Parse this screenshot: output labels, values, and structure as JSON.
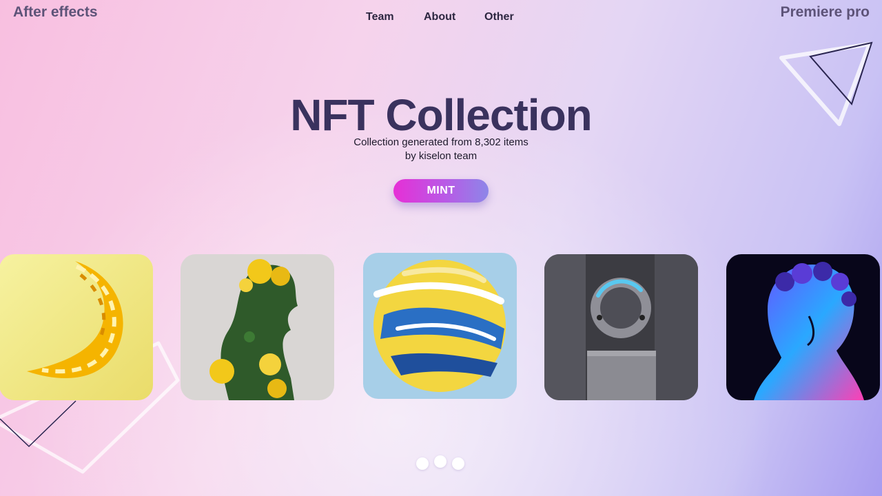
{
  "header": {
    "left_brand": "After effects",
    "right_brand": "Premiere pro",
    "nav": [
      "Team",
      "About",
      "Other"
    ]
  },
  "hero": {
    "title": "NFT Collection",
    "subtitle_line1": "Collection generated from 8,302 items",
    "subtitle_line2": "by kiselon team",
    "cta_label": "MINT"
  },
  "gallery": {
    "cards": [
      {
        "subject": "yellow braided crescent"
      },
      {
        "subject": "floral silhouette of a woman"
      },
      {
        "subject": "painted sphere"
      },
      {
        "subject": "grey machine with ring"
      },
      {
        "subject": "holographic bust statue"
      }
    ],
    "pagination_count": 3
  },
  "colors": {
    "title": "#3a325e",
    "brand_text": "#5d5378",
    "mint_gradient_start": "#e62fd6",
    "mint_gradient_end": "#8d86e8"
  }
}
